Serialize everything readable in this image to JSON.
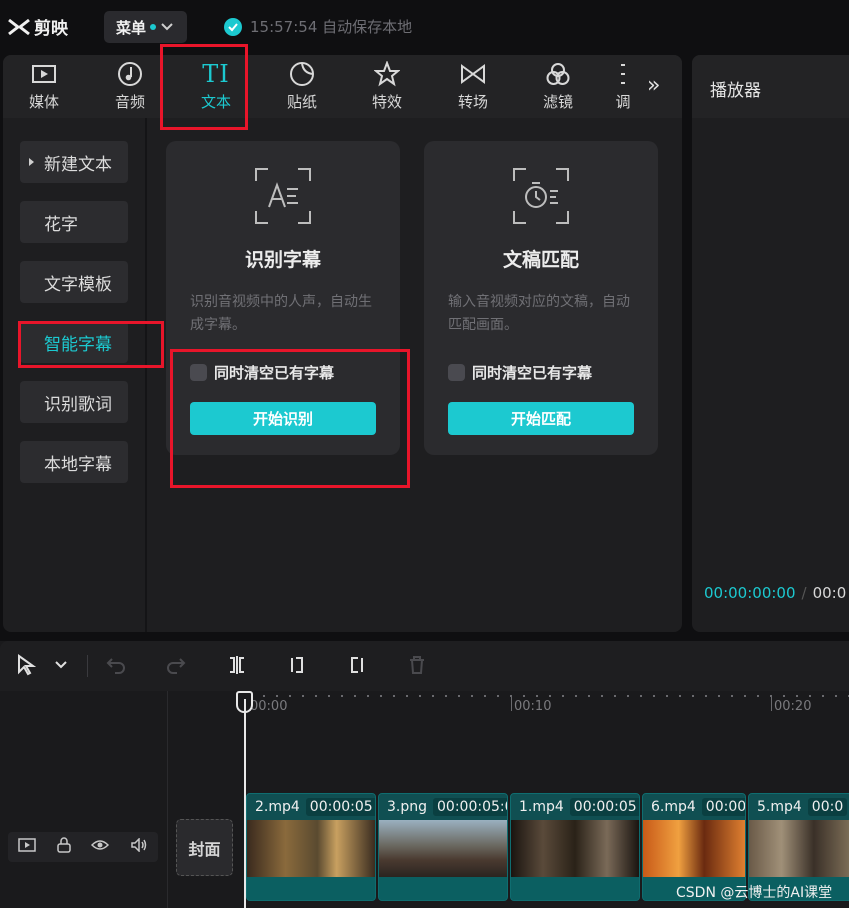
{
  "app": {
    "logo_text": "剪映",
    "menu_label": "菜单",
    "autosave_text": "15:57:54 自动保存本地"
  },
  "tabs": [
    {
      "label": "媒体",
      "icon": "media-icon"
    },
    {
      "label": "音频",
      "icon": "audio-icon"
    },
    {
      "label": "文本",
      "icon": "text-icon"
    },
    {
      "label": "贴纸",
      "icon": "sticker-icon"
    },
    {
      "label": "特效",
      "icon": "effects-icon"
    },
    {
      "label": "转场",
      "icon": "transition-icon"
    },
    {
      "label": "滤镜",
      "icon": "filter-icon"
    },
    {
      "label": "调",
      "icon": "adjust-icon"
    }
  ],
  "active_tab": "文本",
  "sidebar": {
    "items": [
      {
        "label": "新建文本"
      },
      {
        "label": "花字"
      },
      {
        "label": "文字模板"
      },
      {
        "label": "智能字幕"
      },
      {
        "label": "识别歌词"
      },
      {
        "label": "本地字幕"
      }
    ],
    "active": "智能字幕"
  },
  "cards": [
    {
      "title": "识别字幕",
      "desc": "识别音视频中的人声，自动生成字幕。",
      "checkbox_label": "同时清空已有字幕",
      "button_label": "开始识别"
    },
    {
      "title": "文稿匹配",
      "desc": "输入音视频对应的文稿，自动匹配画面。",
      "checkbox_label": "同时清空已有字幕",
      "button_label": "开始匹配"
    }
  ],
  "player": {
    "title": "播放器",
    "current_time": "00:00:00:00",
    "total_time": "00:0"
  },
  "timeline": {
    "ruler": [
      "00:00",
      "00:10",
      "00:20"
    ],
    "cover_label": "封面",
    "clips": [
      {
        "name": "2.mp4",
        "duration": "00:00:05"
      },
      {
        "name": "3.png",
        "duration": "00:00:05:0"
      },
      {
        "name": "1.mp4",
        "duration": "00:00:05"
      },
      {
        "name": "6.mp4",
        "duration": "00:00"
      },
      {
        "name": "5.mp4",
        "duration": "00:0"
      }
    ]
  },
  "watermark": "CSDN @云博士的AI课堂",
  "colors": {
    "accent": "#1cc9d0",
    "annotation": "#e8152a",
    "clip": "#0d5a5c"
  }
}
